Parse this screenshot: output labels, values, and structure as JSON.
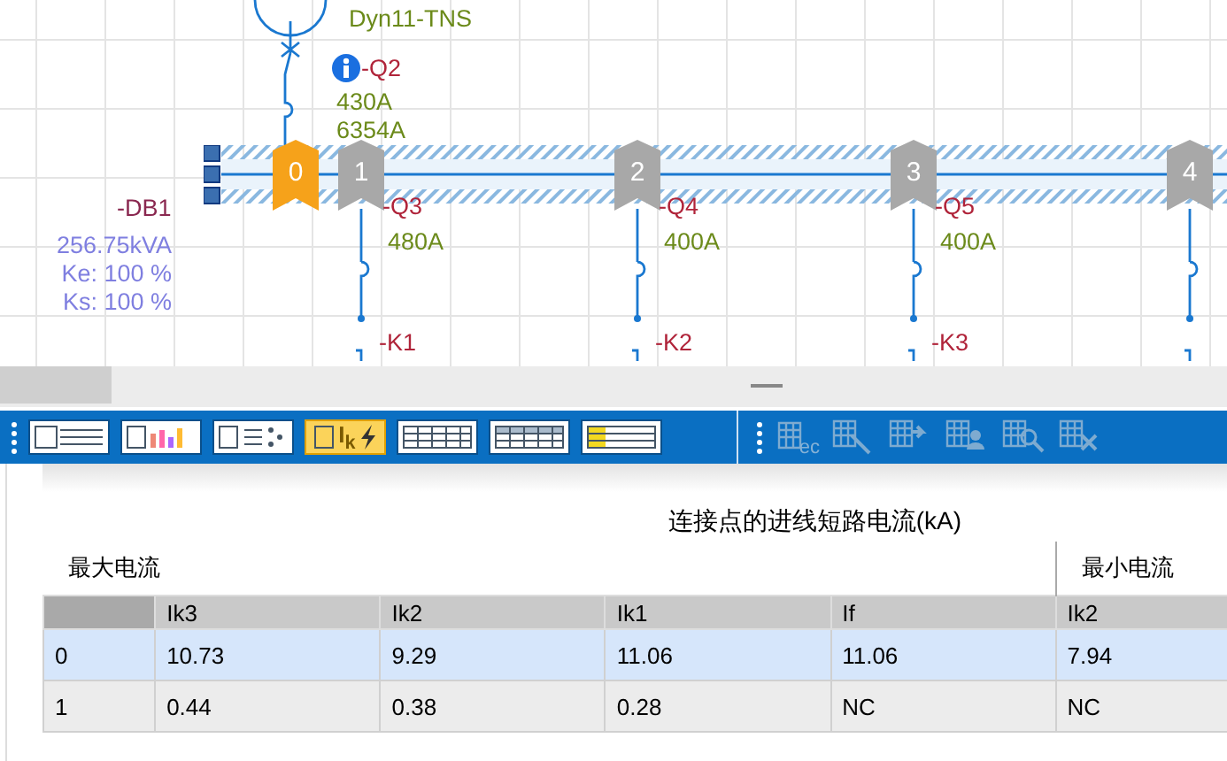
{
  "diagram": {
    "transformer": {
      "vector_group": "Dyn11-TNS"
    },
    "incomer": {
      "name": "-Q2",
      "rating": "430A",
      "current": "6354A"
    },
    "busbar": {
      "name": "-DB1",
      "power": "256.75kVA",
      "ke": "Ke: 100 %",
      "ks": "Ks: 100 %",
      "marker": "0"
    },
    "feeders": [
      {
        "marker": "1",
        "breaker": "-Q3",
        "rating": "480A",
        "contactor": "-K1"
      },
      {
        "marker": "2",
        "breaker": "-Q4",
        "rating": "400A",
        "contactor": "-K2"
      },
      {
        "marker": "3",
        "breaker": "-Q5",
        "rating": "400A",
        "contactor": "-K3"
      },
      {
        "marker": "4"
      }
    ]
  },
  "toolbar": {
    "view_buttons": [
      {
        "kind": "layout",
        "selected": false
      },
      {
        "kind": "chart",
        "selected": false
      },
      {
        "kind": "list",
        "selected": false
      },
      {
        "kind": "ik",
        "label": "I$_{k}$",
        "selected": true
      },
      {
        "kind": "grid",
        "selected": false
      },
      {
        "kind": "grid-header",
        "selected": false
      },
      {
        "kind": "highlight",
        "selected": false
      }
    ],
    "action_buttons": [
      {
        "kind": "ec",
        "label": "ec",
        "disabled": true
      },
      {
        "kind": "pointer",
        "disabled": true
      },
      {
        "kind": "arrow",
        "disabled": true
      },
      {
        "kind": "person",
        "disabled": true
      },
      {
        "kind": "search",
        "disabled": true
      },
      {
        "kind": "delete",
        "disabled": true
      }
    ]
  },
  "table": {
    "caption": "连接点的进线短路电流(kA)",
    "groups": [
      {
        "label": "最大电流"
      },
      {
        "label": "最小电流"
      }
    ],
    "columns": [
      "",
      "Ik3",
      "Ik2",
      "Ik1",
      "If",
      "Ik2"
    ],
    "rows": [
      {
        "selected": true,
        "cells": [
          "0",
          "10.73",
          "9.29",
          "11.06",
          "11.06",
          "7.94"
        ]
      },
      {
        "selected": false,
        "cells": [
          "1",
          "0.44",
          "0.38",
          "0.28",
          "NC",
          "NC"
        ]
      }
    ]
  }
}
